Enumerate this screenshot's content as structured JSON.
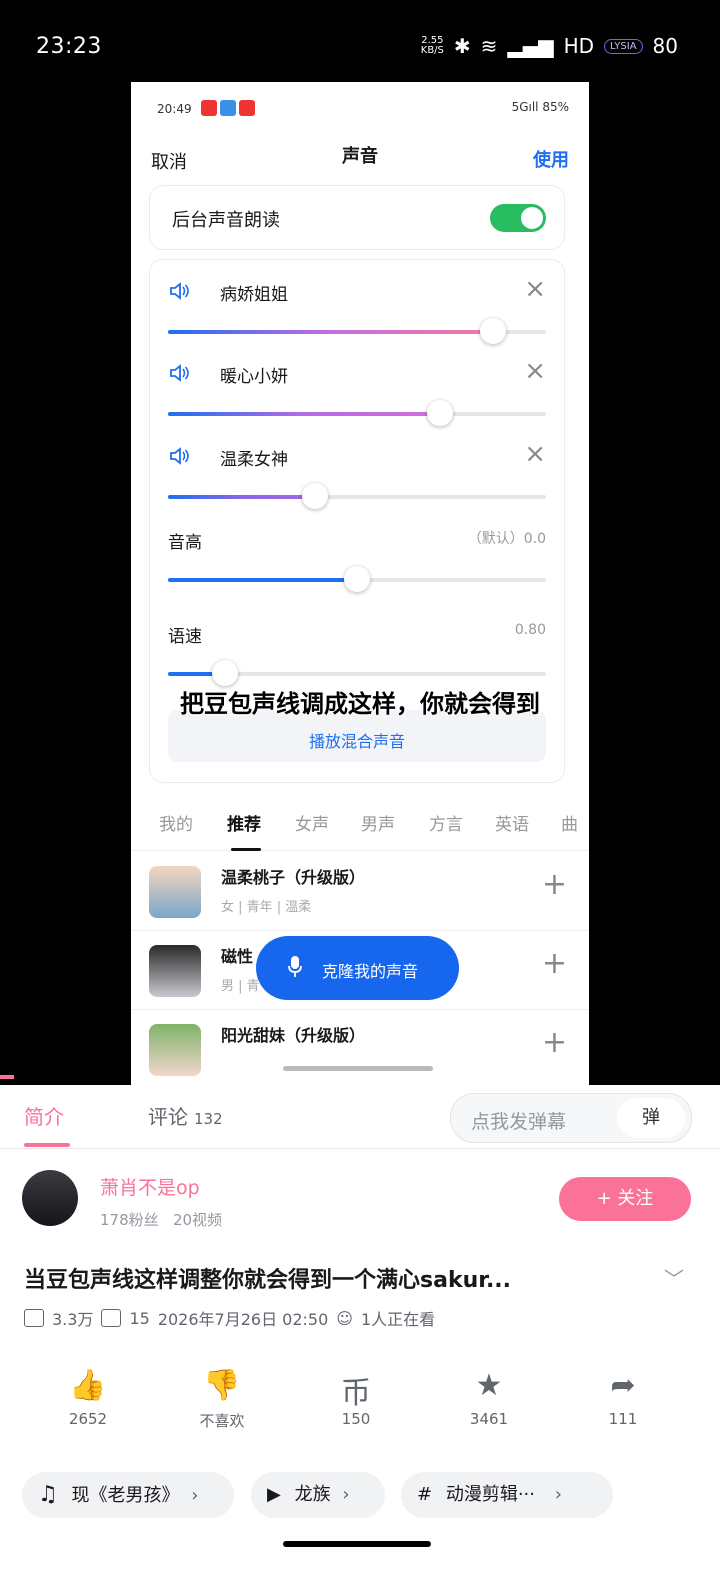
{
  "status_bar": {
    "time": "23:23",
    "net_speed_top": "2.55",
    "net_speed_bottom": "KB/S",
    "hd": "HD",
    "battery_label": "LYSIA",
    "battery": "80"
  },
  "video": {
    "inner_status": {
      "time": "20:49",
      "right": "5Gıll 85%"
    },
    "header": {
      "cancel": "取消",
      "title": "声音",
      "use": "使用"
    },
    "bg_read": {
      "label": "后台声音朗读",
      "enabled": true
    },
    "voices": [
      {
        "name": "病娇姐姐",
        "level": 0.86,
        "gradient": [
          "#1e6ff1",
          "#c46ee0",
          "#f17aa5"
        ]
      },
      {
        "name": "暖心小妍",
        "level": 0.72,
        "gradient": [
          "#1e6ff1",
          "#b56be6",
          "#d070d8"
        ]
      },
      {
        "name": "温柔女神",
        "level": 0.39,
        "gradient": [
          "#1e6ff1",
          "#8a66e8",
          "#a567e4"
        ]
      }
    ],
    "pitch": {
      "label": "音高",
      "value": "（默认）0.0",
      "level": 0.5
    },
    "speed": {
      "label": "语速",
      "value": "0.80",
      "level": 0.15
    },
    "play_mix": "播放混合声音",
    "caption": "把豆包声线调成这样，你就会得到",
    "tabs": [
      "我的",
      "推荐",
      "女声",
      "男声",
      "方言",
      "英语",
      "曲"
    ],
    "list": [
      {
        "name": "温柔桃子（升级版）",
        "tags": "女 | 青年 | 温柔"
      },
      {
        "name": "磁性",
        "tags": "男 | 青"
      },
      {
        "name": "阳光甜妹（升级版）",
        "tags": ""
      }
    ],
    "clone_button": "克隆我的声音"
  },
  "nav": {
    "tab_intro": "简介",
    "tab_comments": "评论",
    "comment_count": "132",
    "danmu_placeholder": "点我发弹幕",
    "danmu_icon": "弹"
  },
  "author": {
    "name": "萧肖不是op",
    "fans": "178粉丝",
    "videos": "20视频",
    "follow": "+ 关注"
  },
  "video_info": {
    "title": "当豆包声线这样调整你就会得到一个满心sakur...",
    "views": "3.3万",
    "danmaku": "15",
    "date": "2026年7月26日 02:50",
    "watching": "1人正在看"
  },
  "actions": [
    {
      "icon": "thumbs-up-icon",
      "glyph": "👍",
      "label": "2652"
    },
    {
      "icon": "thumbs-down-icon",
      "glyph": "👎",
      "label": "不喜欢"
    },
    {
      "icon": "coin-icon",
      "glyph": "币",
      "label": "150"
    },
    {
      "icon": "star-icon",
      "glyph": "★",
      "label": "3461"
    },
    {
      "icon": "share-icon",
      "glyph": "➦",
      "label": "111"
    }
  ],
  "tags": [
    {
      "icon": "music-icon",
      "glyph": "♫",
      "label": "现《老男孩》"
    },
    {
      "icon": "tv-icon",
      "glyph": "▶",
      "label": "龙族"
    },
    {
      "icon": "hashtag-icon",
      "glyph": "#",
      "label": "动漫剪辑···"
    }
  ],
  "colors": {
    "accent": "#fb7299",
    "blue": "#1e6ff1",
    "toggle": "#27bd60"
  }
}
